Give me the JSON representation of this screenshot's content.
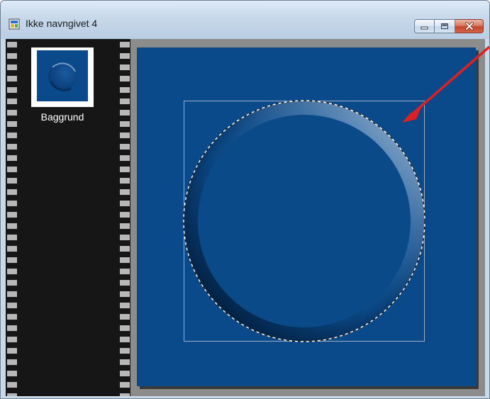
{
  "window": {
    "title": "Ikke navngivet 4",
    "icon": "image-document-icon",
    "buttons": {
      "minimize": "minimize-icon",
      "maximize": "maximize-icon",
      "close": "close-icon"
    }
  },
  "layers_palette": {
    "items": [
      {
        "label": "Baggrund",
        "thumbnail": "layer-thumbnail"
      }
    ]
  },
  "canvas": {
    "background_color": "#0a4a8a",
    "selection": "marching-ants-circle",
    "annotation": "red-arrow"
  },
  "colors": {
    "canvas_blue": "#0a4a8a",
    "arrow_red": "#e02020",
    "close_red": "#c6452a"
  }
}
